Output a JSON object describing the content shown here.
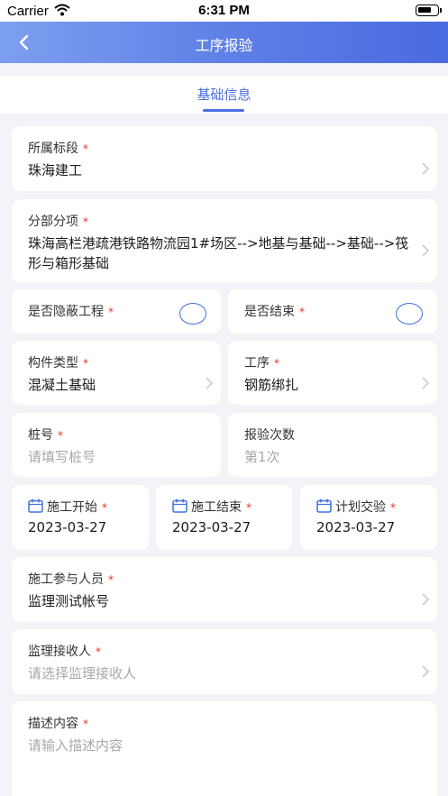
{
  "status_bar": {
    "carrier": "Carrier",
    "time": "6:31 PM"
  },
  "nav": {
    "title": "工序报验"
  },
  "tabs": [
    {
      "label": "基础信息"
    }
  ],
  "form": {
    "section": {
      "label": "所属标段",
      "value": "珠海建工"
    },
    "subitem": {
      "label": "分部分项",
      "value": "珠海高栏港疏港铁路物流园1#场区-->地基与基础-->基础-->筏形与箱形基础"
    },
    "hidden_project": {
      "label": "是否隐蔽工程"
    },
    "is_finished": {
      "label": "是否结束"
    },
    "component_type": {
      "label": "构件类型",
      "value": "混凝土基础"
    },
    "process": {
      "label": "工序",
      "value": "钢筋绑扎"
    },
    "pile_no": {
      "label": "桩号",
      "placeholder": "请填写桩号"
    },
    "inspection_count": {
      "label": "报验次数",
      "value": "第1次"
    },
    "start_date": {
      "label": "施工开始",
      "value": "2023-03-27"
    },
    "end_date": {
      "label": "施工结束",
      "value": "2023-03-27"
    },
    "plan_date": {
      "label": "计划交验",
      "value": "2023-03-27"
    },
    "participants": {
      "label": "施工参与人员",
      "value": "监理测试帐号"
    },
    "receiver": {
      "label": "监理接收人",
      "placeholder": "请选择监理接收人"
    },
    "description": {
      "label": "描述内容",
      "placeholder": "请输入描述内容"
    }
  },
  "required_mark": "*",
  "colors": {
    "accent": "#4a6fe0",
    "required": "#e0322b",
    "background": "#f3f4f7"
  }
}
